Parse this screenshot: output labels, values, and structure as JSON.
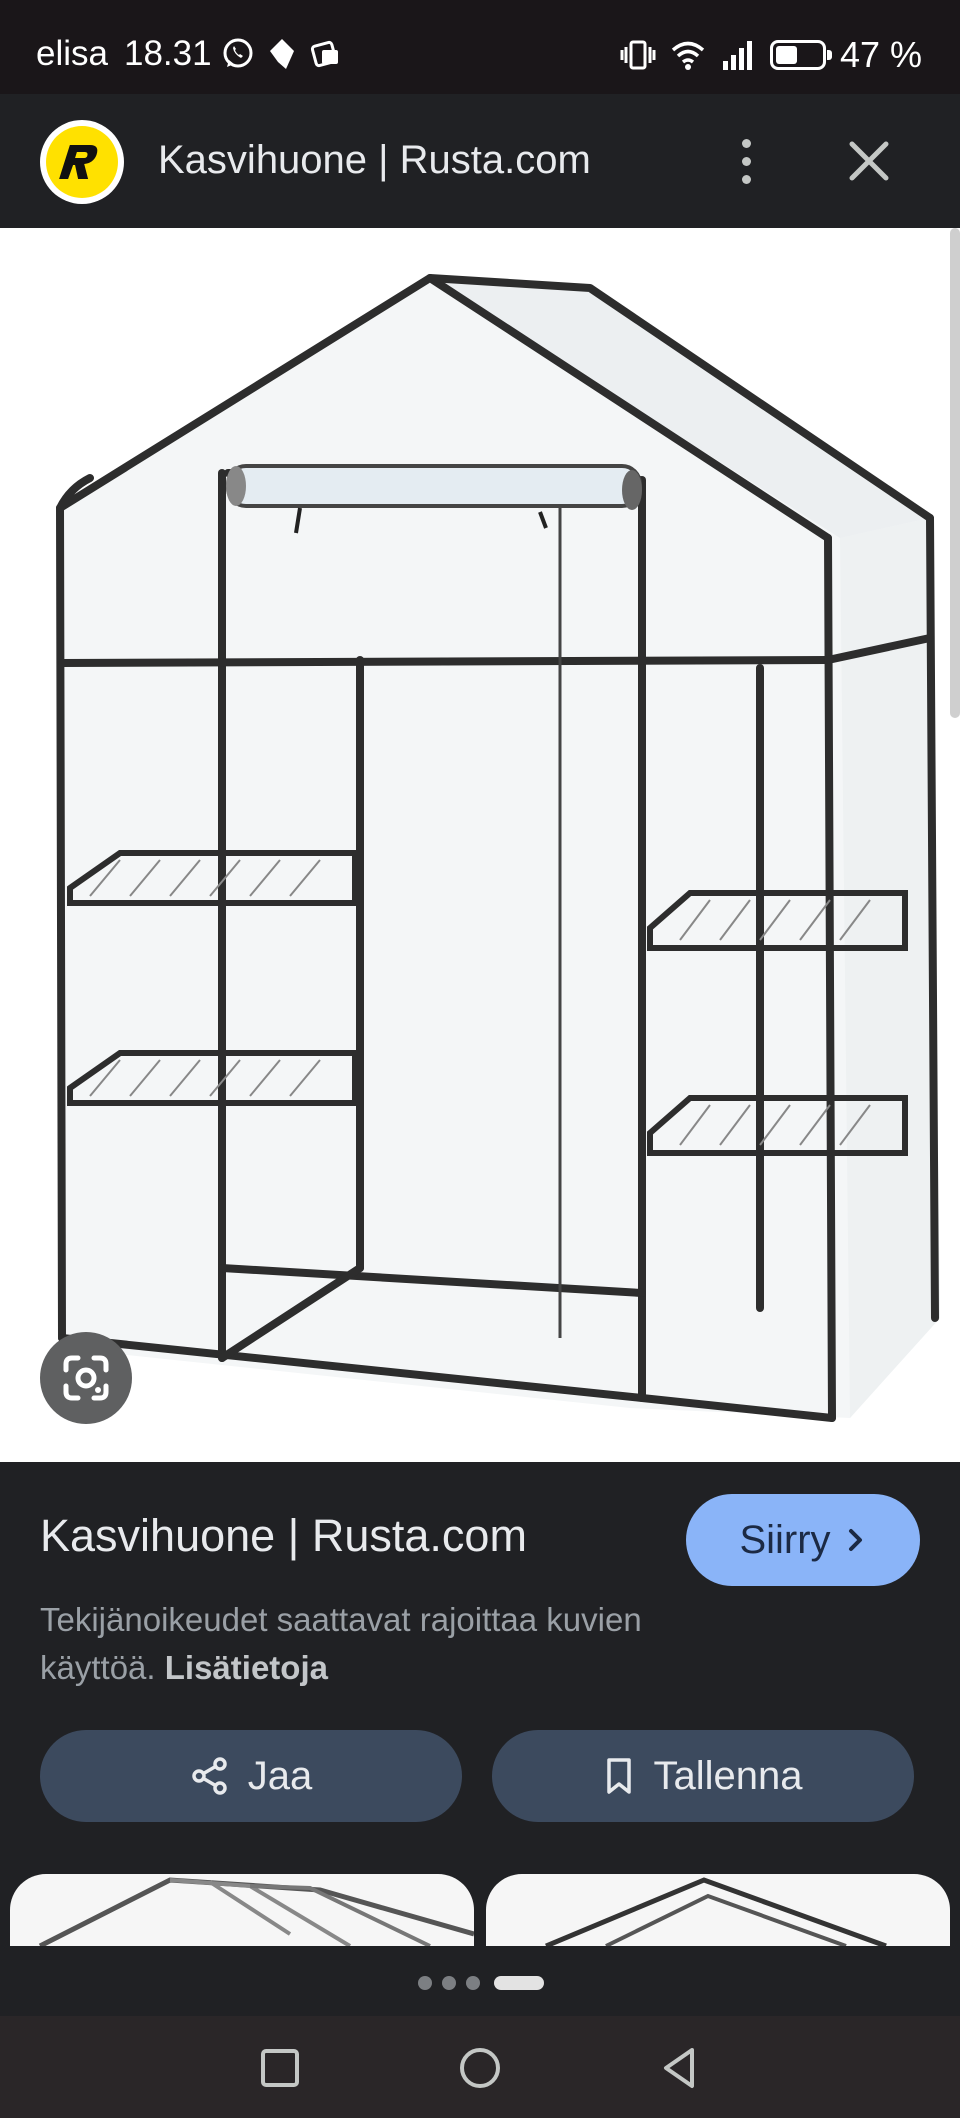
{
  "status_bar": {
    "carrier": "elisa",
    "time": "18.31",
    "battery_percent": "47 %",
    "battery_level": 0.47,
    "left_icons": [
      "whatsapp-icon",
      "messenger-icon",
      "notification-icon"
    ],
    "right_icons": [
      "vibrate-icon",
      "wifi-icon",
      "signal-icon",
      "battery-icon"
    ]
  },
  "header": {
    "site_logo": "rusta-logo",
    "title": "Kasvihuone | Rusta.com",
    "more_icon": "more-vert-icon",
    "close_icon": "close-icon"
  },
  "image": {
    "subject": "greenhouse",
    "lens_icon": "google-lens-icon"
  },
  "info": {
    "title": "Kasvihuone | Rusta.com",
    "visit_label": "Siirry",
    "copyright_text": "Tekijänoikeudet saattavat rajoittaa kuvien käyttöä.",
    "learn_more": "Lisätietoja"
  },
  "actions": {
    "share_label": "Jaa",
    "save_label": "Tallenna"
  },
  "pager": {
    "total": 4,
    "active": 4
  },
  "nav": {
    "recents_icon": "square-recents-icon",
    "home_icon": "circle-home-icon",
    "back_icon": "triangle-back-icon"
  },
  "colors": {
    "background": "#202124",
    "accent_button": "#8ab4f8",
    "action_button": "#3c4a5e",
    "logo_yellow": "#ffe100"
  }
}
